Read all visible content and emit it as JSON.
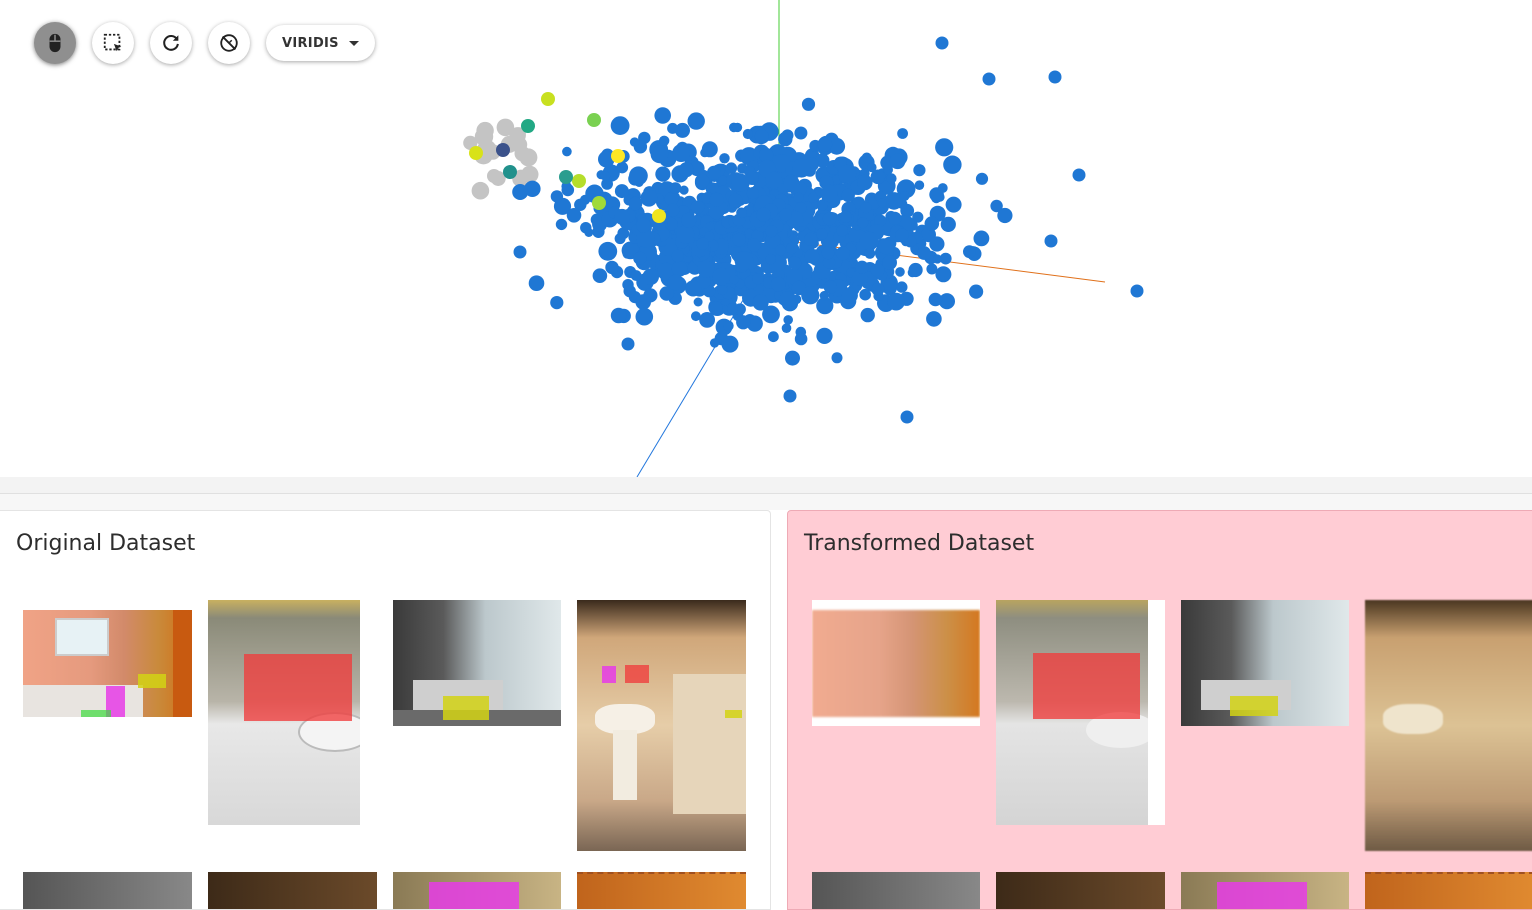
{
  "toolbar": {
    "buttons": [
      {
        "name": "mouse-mode-button",
        "icon": "mouse-icon",
        "active": true
      },
      {
        "name": "lasso-select-button",
        "icon": "selection-icon",
        "active": false
      },
      {
        "name": "reset-view-button",
        "icon": "refresh-icon",
        "active": false
      },
      {
        "name": "clear-selection-button",
        "icon": "hide-icon",
        "active": false
      }
    ],
    "colormap_label": "VIRIDIS"
  },
  "panels": {
    "original": {
      "title": "Original Dataset"
    },
    "transformed": {
      "title": "Transformed Dataset"
    }
  },
  "colors": {
    "point": "#1f77d4",
    "unselected_point": "#c4c4c4",
    "axis_x": "#e0701a",
    "axis_y": "#44cc33",
    "axis_z": "#2277dd",
    "transformed_panel": "#ffccd4"
  }
}
